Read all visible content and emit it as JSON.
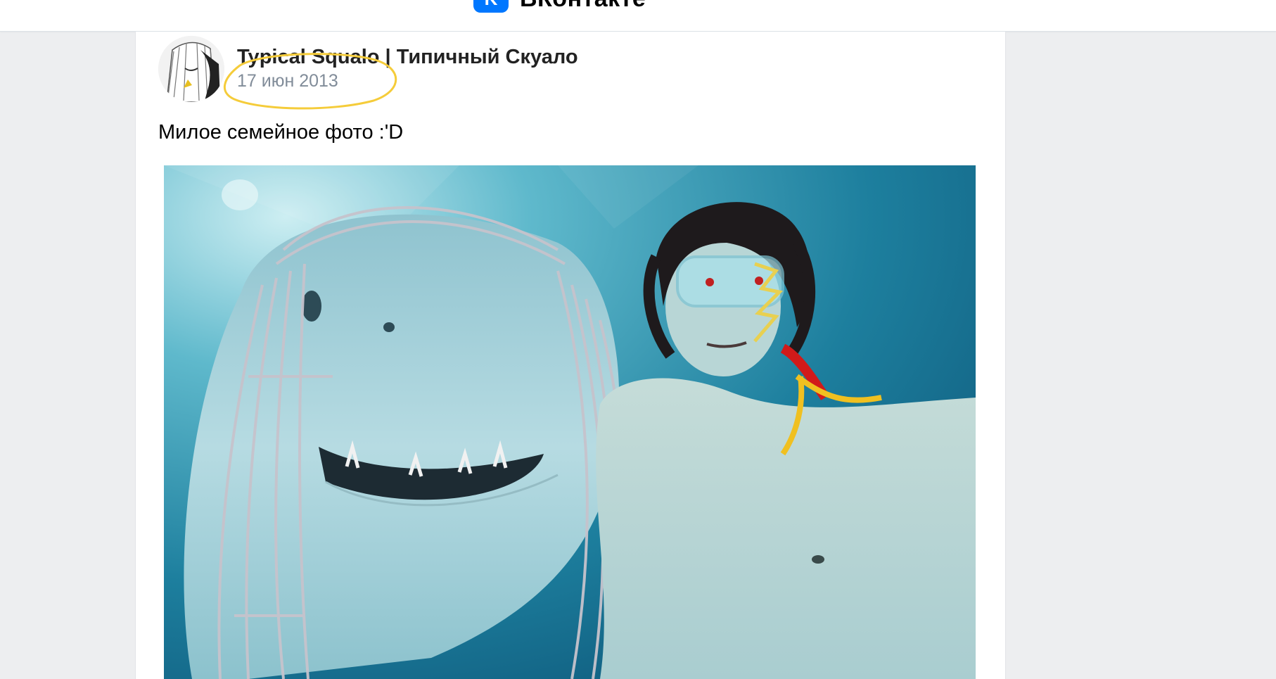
{
  "header": {
    "logo_letter": "K",
    "brand_name": "ВКонтакте"
  },
  "post": {
    "author": "Typical Squalo | Типичный Скуало",
    "date": "17 июн 2013",
    "text": "Милое семейное фото :'D",
    "highlight_color": "#f5cc3a"
  },
  "colors": {
    "background": "#edeef0",
    "accent": "#0077ff",
    "date_text": "#818c99"
  }
}
